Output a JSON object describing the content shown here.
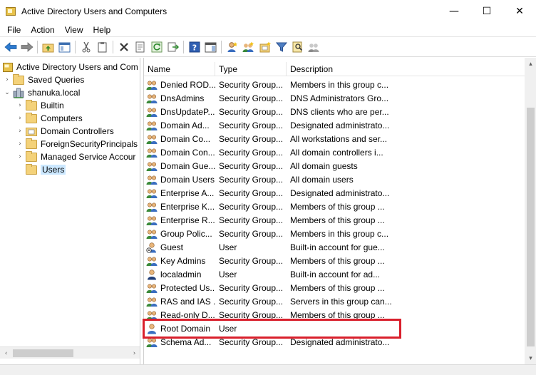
{
  "window": {
    "title": "Active Directory Users and Computers",
    "controls": {
      "minimize": "—",
      "maximize": "☐",
      "close": "✕"
    }
  },
  "menu": [
    "File",
    "Action",
    "View",
    "Help"
  ],
  "toolbar": {
    "icons": [
      "back-arrow-icon",
      "forward-arrow-icon",
      "up-folder-icon",
      "show-console-tree-icon",
      "cut-icon",
      "copy-icon",
      "delete-icon",
      "properties-icon",
      "refresh-icon",
      "export-list-icon",
      "help-icon",
      "action-pane-icon",
      "new-user-icon",
      "new-group-icon",
      "new-ou-icon",
      "filter-icon",
      "find-icon",
      "add-to-group-icon"
    ]
  },
  "tree": {
    "root": "Active Directory Users and Com",
    "items": [
      {
        "label": "Saved Queries",
        "level": 1,
        "expander": "›",
        "icon": "folder"
      },
      {
        "label": "shanuka.local",
        "level": 1,
        "expander": "⌄",
        "icon": "domain"
      },
      {
        "label": "Builtin",
        "level": 2,
        "expander": "›",
        "icon": "folder"
      },
      {
        "label": "Computers",
        "level": 2,
        "expander": "›",
        "icon": "folder"
      },
      {
        "label": "Domain Controllers",
        "level": 2,
        "expander": "›",
        "icon": "ou"
      },
      {
        "label": "ForeignSecurityPrincipals",
        "level": 2,
        "expander": "›",
        "icon": "folder"
      },
      {
        "label": "Managed Service Accour",
        "level": 2,
        "expander": "›",
        "icon": "folder"
      },
      {
        "label": "Users",
        "level": 2,
        "expander": "",
        "icon": "folder",
        "selected": true
      }
    ]
  },
  "list": {
    "columns": [
      "Name",
      "Type",
      "Description"
    ],
    "rows": [
      {
        "name": "Denied ROD...",
        "type": "Security Group...",
        "description": "Members in this group c...",
        "kind": "group"
      },
      {
        "name": "DnsAdmins",
        "type": "Security Group...",
        "description": "DNS Administrators Gro...",
        "kind": "group"
      },
      {
        "name": "DnsUpdateP...",
        "type": "Security Group...",
        "description": "DNS clients who are per...",
        "kind": "group"
      },
      {
        "name": "Domain Ad...",
        "type": "Security Group...",
        "description": "Designated administrato...",
        "kind": "group"
      },
      {
        "name": "Domain Co...",
        "type": "Security Group...",
        "description": "All workstations and ser...",
        "kind": "group"
      },
      {
        "name": "Domain Con...",
        "type": "Security Group...",
        "description": "All domain controllers i...",
        "kind": "group"
      },
      {
        "name": "Domain Gue...",
        "type": "Security Group...",
        "description": "All domain guests",
        "kind": "group"
      },
      {
        "name": "Domain Users",
        "type": "Security Group...",
        "description": "All domain users",
        "kind": "group"
      },
      {
        "name": "Enterprise A...",
        "type": "Security Group...",
        "description": "Designated administrato...",
        "kind": "group"
      },
      {
        "name": "Enterprise K...",
        "type": "Security Group...",
        "description": "Members of this group ...",
        "kind": "group"
      },
      {
        "name": "Enterprise R...",
        "type": "Security Group...",
        "description": "Members of this group ...",
        "kind": "group"
      },
      {
        "name": "Group Polic...",
        "type": "Security Group...",
        "description": "Members in this group c...",
        "kind": "group"
      },
      {
        "name": "Guest",
        "type": "User",
        "description": "Built-in account for gue...",
        "kind": "user-disabled"
      },
      {
        "name": "Key Admins",
        "type": "Security Group...",
        "description": "Members of this group ...",
        "kind": "group"
      },
      {
        "name": "localadmin",
        "type": "User",
        "description": "Built-in account for ad...",
        "kind": "user-admin"
      },
      {
        "name": "Protected Us...",
        "type": "Security Group...",
        "description": "Members of this group ...",
        "kind": "group"
      },
      {
        "name": "RAS and IAS ...",
        "type": "Security Group...",
        "description": "Servers in this group can...",
        "kind": "group"
      },
      {
        "name": "Read-only D...",
        "type": "Security Group...",
        "description": "Members of this group ...",
        "kind": "group"
      },
      {
        "name": "Root Domain",
        "type": "User",
        "description": "",
        "kind": "user"
      },
      {
        "name": "Schema Ad...",
        "type": "Security Group...",
        "description": "Designated administrato...",
        "kind": "group"
      }
    ]
  },
  "scroll": {
    "up": "▴",
    "down": "▾",
    "left": "‹",
    "right": "›"
  },
  "colors": {
    "highlight": "#d9202c",
    "selection": "#cce8ff",
    "folder": "#f4d27a"
  }
}
